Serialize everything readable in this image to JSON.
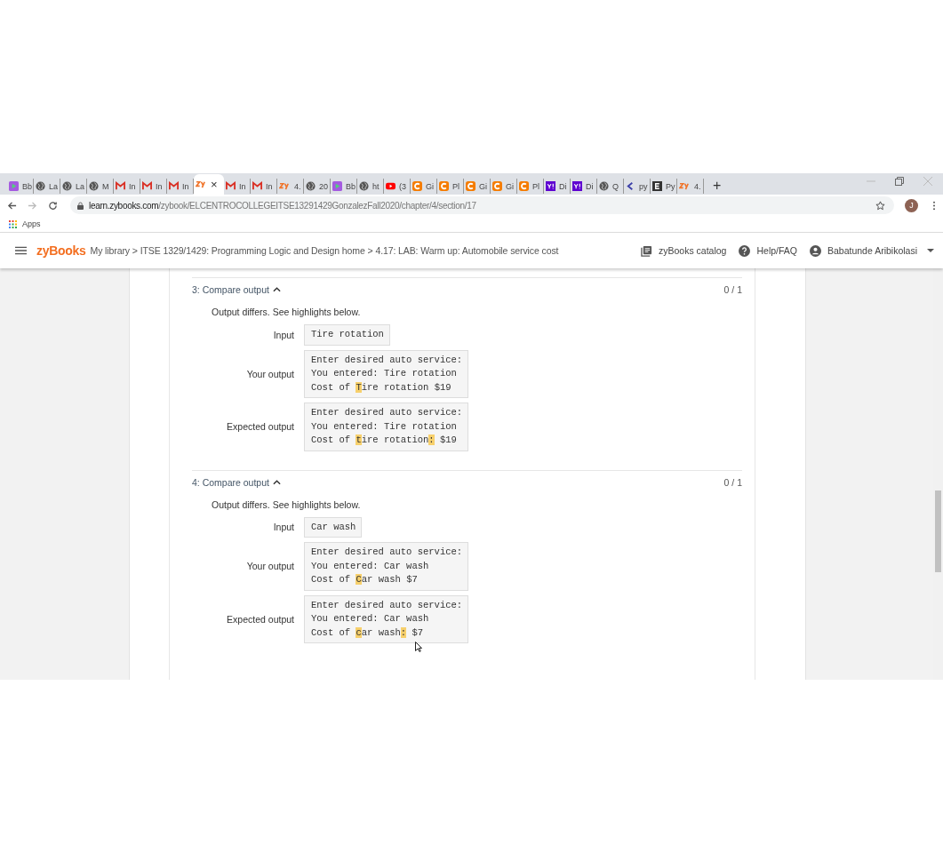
{
  "browser": {
    "tabs": [
      {
        "kind": "play",
        "label": "Bb",
        "selected": false
      },
      {
        "kind": "globe",
        "label": "La",
        "selected": false
      },
      {
        "kind": "globe",
        "label": "La",
        "selected": false
      },
      {
        "kind": "globe",
        "label": "M",
        "selected": false
      },
      {
        "kind": "gmail",
        "label": "In",
        "selected": false
      },
      {
        "kind": "gmail",
        "label": "In",
        "selected": false
      },
      {
        "kind": "gmail",
        "label": "In",
        "selected": false
      },
      {
        "kind": "zy",
        "selected": true,
        "close": "×"
      },
      {
        "kind": "gmail",
        "label": "In",
        "selected": false
      },
      {
        "kind": "gmail",
        "label": "In",
        "selected": false
      },
      {
        "kind": "zy",
        "label": "4.",
        "selected": false
      },
      {
        "kind": "globe",
        "label": "20",
        "selected": false
      },
      {
        "kind": "play",
        "label": "Bb",
        "selected": false
      },
      {
        "kind": "globe",
        "label": "ht",
        "selected": false
      },
      {
        "kind": "youtube",
        "label": "(3",
        "selected": false
      },
      {
        "kind": "c",
        "label": "Gi",
        "selected": false
      },
      {
        "kind": "c",
        "label": "Pl",
        "selected": false
      },
      {
        "kind": "c",
        "label": "Gi",
        "selected": false
      },
      {
        "kind": "c",
        "label": "Gi",
        "selected": false
      },
      {
        "kind": "c",
        "label": "Pl",
        "selected": false
      },
      {
        "kind": "yahoo",
        "label": "Di",
        "selected": false
      },
      {
        "kind": "yahoo",
        "label": "Di",
        "selected": false
      },
      {
        "kind": "globe",
        "label": "Q",
        "selected": false
      },
      {
        "kind": "chevron",
        "label": "py",
        "selected": false
      },
      {
        "kind": "e",
        "label": "Py",
        "selected": false
      },
      {
        "kind": "zy",
        "label": "4.",
        "selected": false
      }
    ],
    "new_tab": "+",
    "url_host": "learn.zybooks.com",
    "url_path": "/zybook/ELCENTROCOLLEGEITSE13291429GonzalezFall2020/chapter/4/section/17",
    "profile_initial": "J",
    "bookmarks": [
      "Apps"
    ]
  },
  "header": {
    "logo": "zyBooks",
    "breadcrumb": "My library > ITSE 1329/1429: Programming Logic and Design home > 4.17: LAB: Warm up: Automobile service cost",
    "catalog": "zyBooks catalog",
    "help": "Help/FAQ",
    "user": "Babatunde Aribikolasi"
  },
  "tests": [
    {
      "title": "3: Compare output",
      "score": "0 / 1",
      "expanded": true,
      "message": "Output differs. See highlights below.",
      "rows": [
        {
          "label": "Input",
          "lines": [
            [
              {
                "text": "Tire rotation",
                "highlighted": false
              }
            ]
          ]
        },
        {
          "label": "Your output",
          "lines": [
            [
              {
                "text": "Enter desired auto service:",
                "highlighted": false
              }
            ],
            [
              {
                "text": "You entered: Tire rotation",
                "highlighted": false
              }
            ],
            [
              {
                "text": "Cost of ",
                "highlighted": false
              },
              {
                "text": "T",
                "highlighted": true
              },
              {
                "text": "ire rotation $19",
                "highlighted": false
              }
            ]
          ]
        },
        {
          "label": "Expected output",
          "lines": [
            [
              {
                "text": "Enter desired auto service:",
                "highlighted": false
              }
            ],
            [
              {
                "text": "You entered: Tire rotation",
                "highlighted": false
              }
            ],
            [
              {
                "text": "Cost of ",
                "highlighted": false
              },
              {
                "text": "t",
                "highlighted": true
              },
              {
                "text": "ire rotation",
                "highlighted": false
              },
              {
                "text": ":",
                "highlighted": true
              },
              {
                "text": " $19",
                "highlighted": false
              }
            ]
          ]
        }
      ]
    },
    {
      "title": "4: Compare output",
      "score": "0 / 1",
      "expanded": true,
      "message": "Output differs. See highlights below.",
      "rows": [
        {
          "label": "Input",
          "lines": [
            [
              {
                "text": "Car wash",
                "highlighted": false
              }
            ]
          ]
        },
        {
          "label": "Your output",
          "lines": [
            [
              {
                "text": "Enter desired auto service:",
                "highlighted": false
              }
            ],
            [
              {
                "text": "You entered: Car wash",
                "highlighted": false
              }
            ],
            [
              {
                "text": "Cost of ",
                "highlighted": false
              },
              {
                "text": "C",
                "highlighted": true
              },
              {
                "text": "ar wash $7",
                "highlighted": false
              }
            ]
          ]
        },
        {
          "label": "Expected output",
          "lines": [
            [
              {
                "text": "Enter desired auto service:",
                "highlighted": false
              }
            ],
            [
              {
                "text": "You entered: Car wash",
                "highlighted": false
              }
            ],
            [
              {
                "text": "Cost of ",
                "highlighted": false
              },
              {
                "text": "c",
                "highlighted": true
              },
              {
                "text": "ar wash",
                "highlighted": false
              },
              {
                "text": ":",
                "highlighted": true
              },
              {
                "text": " $7",
                "highlighted": false
              }
            ]
          ]
        }
      ]
    }
  ]
}
